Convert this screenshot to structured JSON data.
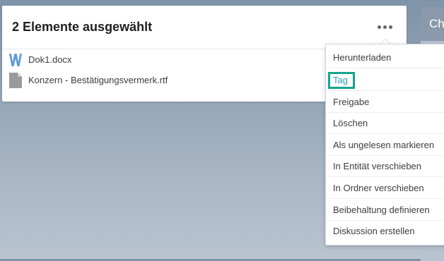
{
  "right_panel": {
    "header_text": "Ch"
  },
  "selection": {
    "title": "2 Elemente ausgewählt",
    "more_icon": "more-horizontal-icon",
    "files": [
      {
        "name": "Dok1.docx",
        "icon": "word-document-icon",
        "icon_color": "#5a9bd5"
      },
      {
        "name": "Konzern - Bestätigungsvermerk.rtf",
        "icon": "generic-file-icon",
        "icon_color": "#9a9a9a"
      }
    ]
  },
  "menu": {
    "items": [
      {
        "label": "Herunterladen"
      },
      {
        "label": "Tag"
      },
      {
        "label": "Freigabe"
      },
      {
        "label": "Löschen"
      },
      {
        "label": "Als ungelesen markieren"
      },
      {
        "label": "In Entität verschieben"
      },
      {
        "label": "In Ordner verschieben"
      },
      {
        "label": "Beibehaltung definieren"
      },
      {
        "label": "Diskussion erstellen"
      }
    ],
    "highlight_color": "#17a38e"
  }
}
